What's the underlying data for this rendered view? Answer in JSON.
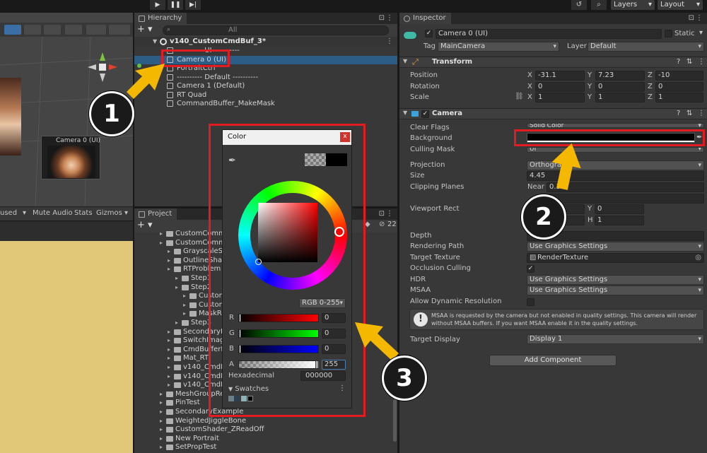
{
  "colors": {
    "accent_red": "#e31b23",
    "arrow_yellow": "#f5b800",
    "game_view_bg": "#e0c878",
    "selection": "#2c5d87"
  },
  "top_toolbar": {
    "layers_label": "Layers",
    "layout_label": "Layout"
  },
  "scene": {
    "game_tools": [
      "used",
      "Mute Audio",
      "Stats",
      "Gizmos"
    ],
    "camera_preview_label": "Camera 0 (UI)"
  },
  "hierarchy": {
    "tab": "Hierarchy",
    "search_placeholder": "All",
    "scene_name": "v140_CustomCmdBuf_3*",
    "items": [
      {
        "label": "---------- UI ----------",
        "indent": 1
      },
      {
        "label": "Camera 0 (UI)",
        "indent": 1,
        "selected": true
      },
      {
        "label": "PortraitCtrl",
        "indent": 1
      },
      {
        "label": "---------- Default ----------",
        "indent": 1
      },
      {
        "label": "Camera 1 (Default)",
        "indent": 1
      },
      {
        "label": "RT Quad",
        "indent": 1
      },
      {
        "label": "CommandBuffer_MakeMask",
        "indent": 1
      }
    ]
  },
  "project": {
    "tab": "Project",
    "count_badge": "22",
    "items": [
      {
        "label": "CustomComma",
        "depth": 0
      },
      {
        "label": "CustomComma",
        "depth": 0
      },
      {
        "label": "GrayscaleSh",
        "depth": 1
      },
      {
        "label": "OutlineShade",
        "depth": 1
      },
      {
        "label": "RTProblem",
        "depth": 1
      },
      {
        "label": "Step1",
        "depth": 2
      },
      {
        "label": "Step2",
        "depth": 2
      },
      {
        "label": "Custom",
        "depth": 3
      },
      {
        "label": "Custom",
        "depth": 3
      },
      {
        "label": "MaskRe",
        "depth": 3
      },
      {
        "label": "Step3",
        "depth": 2
      },
      {
        "label": "SecondaryIm",
        "depth": 1
      },
      {
        "label": "SwitchImage",
        "depth": 1
      },
      {
        "label": "CmdBufferRT",
        "depth": 1
      },
      {
        "label": "Mat_RT",
        "depth": 1
      },
      {
        "label": "v140_CmdBu",
        "depth": 1
      },
      {
        "label": "v140_CmdBu",
        "depth": 1
      },
      {
        "label": "v140_CmdBu",
        "depth": 1
      },
      {
        "label": "MeshGroupRele",
        "depth": 0
      },
      {
        "label": "PinTest",
        "depth": 0
      },
      {
        "label": "SecondaryExample",
        "depth": 0
      },
      {
        "label": "WeightedJiggleBone",
        "depth": 0
      },
      {
        "label": "CustomShader_ZReadOff",
        "depth": 0
      },
      {
        "label": "New Portrait",
        "depth": 0
      },
      {
        "label": "SetPropTest",
        "depth": 0
      }
    ]
  },
  "inspector": {
    "tab": "Inspector",
    "object_name": "Camera 0 (UI)",
    "static_label": "Static",
    "tag_label": "Tag",
    "tag_value": "MainCamera",
    "layer_label": "Layer",
    "layer_value": "Default",
    "transform": {
      "title": "Transform",
      "position_label": "Position",
      "position": [
        "-31.1",
        "7.23",
        "-10"
      ],
      "rotation_label": "Rotation",
      "rotation": [
        "0",
        "0",
        "0"
      ],
      "scale_label": "Scale",
      "scale": [
        "1",
        "1",
        "1"
      ]
    },
    "camera": {
      "title": "Camera",
      "clear_flags_label": "Clear Flags",
      "clear_flags_value": "Solid Color",
      "background_label": "Background",
      "culling_mask_label": "Culling Mask",
      "culling_mask_value": "UI",
      "projection_label": "Projection",
      "projection_value": "Orthographic",
      "size_label": "Size",
      "size_value": "4.45",
      "clipping_label": "Clipping Planes",
      "near_label": "Near",
      "near_value": "0.3",
      "viewport_label": "Viewport Rect",
      "vp_y_label": "Y",
      "vp_y": "0",
      "vp_h_label": "H",
      "vp_h": "1",
      "depth_label": "Depth",
      "rendering_path_label": "Rendering Path",
      "rendering_path_value": "Use Graphics Settings",
      "target_texture_label": "Target Texture",
      "target_texture_value": "RenderTexture",
      "occlusion_label": "Occlusion Culling",
      "hdr_label": "HDR",
      "hdr_value": "Use Graphics Settings",
      "msaa_label": "MSAA",
      "msaa_value": "Use Graphics Settings",
      "dynamic_res_label": "Allow Dynamic Resolution",
      "msaa_warning": "MSAA is requested by the camera but not enabled in quality settings. This camera will render without MSAA buffers. If you want MSAA enable it in the quality settings.",
      "target_display_label": "Target Display",
      "target_display_value": "Display 1"
    },
    "add_component": "Add Component"
  },
  "color_picker": {
    "title": "Color",
    "close_glyph": "x",
    "mode": "RGB 0-255",
    "channels": [
      {
        "name": "R",
        "value": "0",
        "fill_color": "#ff0000"
      },
      {
        "name": "G",
        "value": "0",
        "fill_color": "#00ff00"
      },
      {
        "name": "B",
        "value": "0",
        "fill_color": "#0000ff"
      },
      {
        "name": "A",
        "value": "255",
        "fill_color": "#ffffff"
      }
    ],
    "hex_label": "Hexadecimal",
    "hex_value": "000000",
    "swatches_label": "Swatches"
  },
  "annotations": {
    "badge_1": "1",
    "badge_2": "2",
    "badge_3": "3"
  }
}
